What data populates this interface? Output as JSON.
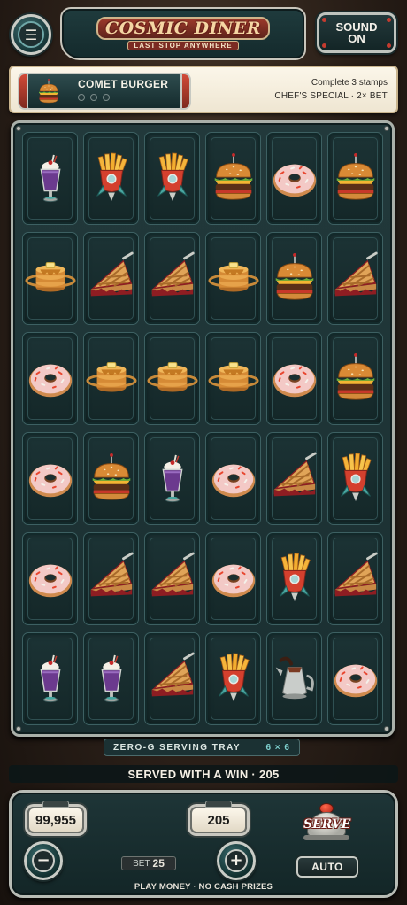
{
  "header": {
    "menu_icon": "hamburger-menu-icon",
    "logo_title": "COSMIC DINER",
    "logo_subtitle": "LAST STOP ANYWHERE",
    "sound_label_line1": "SOUND",
    "sound_label_line2": "ON"
  },
  "order": {
    "name": "COMET BURGER",
    "thumb_icon": "burger-icon",
    "stamps_total": 3,
    "stamps_filled": 0,
    "instruction": "Complete 3 stamps",
    "special": "CHEF'S SPECIAL · 2× BET"
  },
  "board": {
    "grid": [
      [
        "milkshake",
        "fries",
        "fries",
        "burger",
        "donut",
        "burger"
      ],
      [
        "pancakes",
        "pie",
        "pie",
        "pancakes",
        "burger",
        "pie"
      ],
      [
        "donut",
        "pancakes",
        "pancakes",
        "pancakes",
        "donut",
        "burger"
      ],
      [
        "donut",
        "burger",
        "milkshake",
        "donut",
        "pie",
        "fries"
      ],
      [
        "donut",
        "pie",
        "pie",
        "donut",
        "fries",
        "pie"
      ],
      [
        "milkshake",
        "milkshake",
        "pie",
        "fries",
        "coffee-pot",
        "donut"
      ]
    ],
    "tray_label": "ZERO-G SERVING TRAY",
    "tray_size": "6 × 6"
  },
  "result": {
    "message": "SERVED WITH A WIN · 205"
  },
  "controls": {
    "balance": "99,955",
    "win": "205",
    "bet_label": "BET",
    "bet_value": "25",
    "minus_label": "−",
    "plus_label": "+",
    "serve_label": "SERVE",
    "auto_label": "AUTO",
    "disclaimer": "PLAY MONEY · NO CASH PRIZES"
  },
  "colors": {
    "panel_teal": "#1e3537",
    "chrome": "#c9ccc6",
    "accent_red": "#c43b2f",
    "cream": "#fbf6e9"
  }
}
